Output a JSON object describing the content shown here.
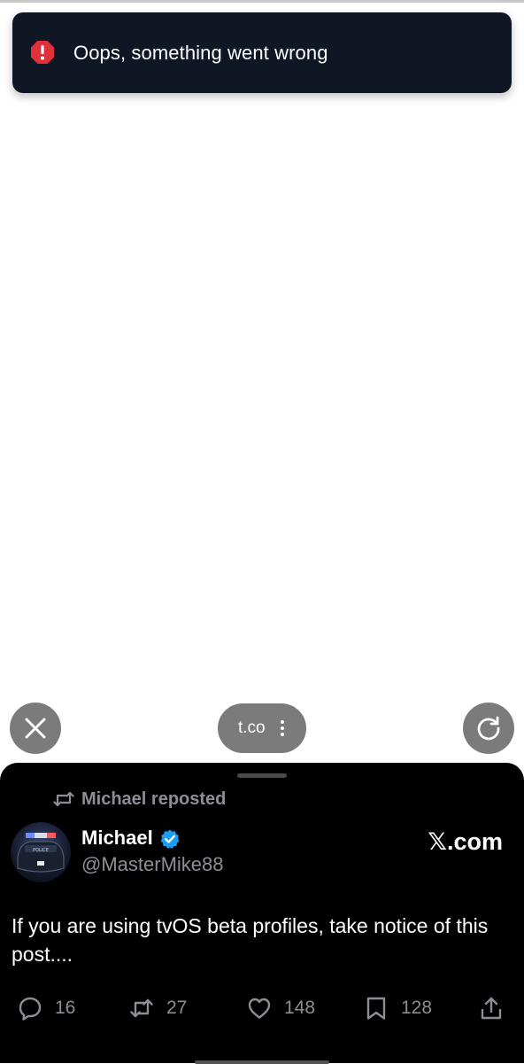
{
  "toast": {
    "icon": "alert-octagon-icon",
    "message": "Oops, something went wrong"
  },
  "browser_controls": {
    "close_icon": "close-icon",
    "url_label": "t.co",
    "menu_icon": "kebab-menu-icon",
    "reload_icon": "reload-icon"
  },
  "post": {
    "repost_label": "Michael reposted",
    "author_name": "Michael",
    "author_handle": "@MasterMike88",
    "site_brand": "𝕏.com",
    "text": "If you are using tvOS beta profiles, take notice of this post....",
    "stats": {
      "replies": "16",
      "reposts": "27",
      "likes": "148",
      "bookmarks": "128"
    },
    "colors": {
      "verified": "#1d9bf0",
      "muted": "#8b8f94"
    }
  }
}
